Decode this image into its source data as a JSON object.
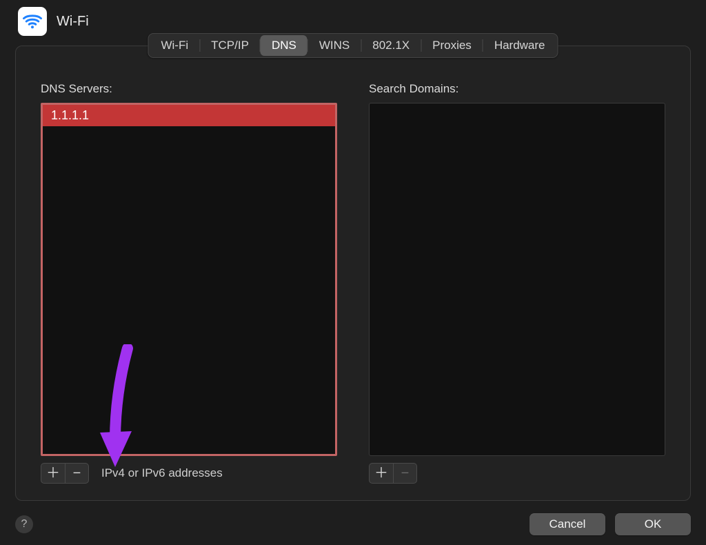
{
  "window": {
    "title": "Wi-Fi"
  },
  "tabs": [
    {
      "label": "Wi-Fi",
      "selected": false
    },
    {
      "label": "TCP/IP",
      "selected": false
    },
    {
      "label": "DNS",
      "selected": true
    },
    {
      "label": "WINS",
      "selected": false
    },
    {
      "label": "802.1X",
      "selected": false
    },
    {
      "label": "Proxies",
      "selected": false
    },
    {
      "label": "Hardware",
      "selected": false
    }
  ],
  "dns": {
    "label": "DNS Servers:",
    "servers": [
      "1.1.1.1"
    ],
    "hint": "IPv4 or IPv6 addresses",
    "addGlyph": "＋",
    "removeGlyph": "−"
  },
  "searchDomains": {
    "label": "Search Domains:",
    "domains": [],
    "addGlyph": "＋",
    "removeGlyph": "−"
  },
  "buttons": {
    "cancel": "Cancel",
    "ok": "OK"
  },
  "helpGlyph": "?",
  "annotation": {
    "arrowColor": "#a032f0"
  }
}
